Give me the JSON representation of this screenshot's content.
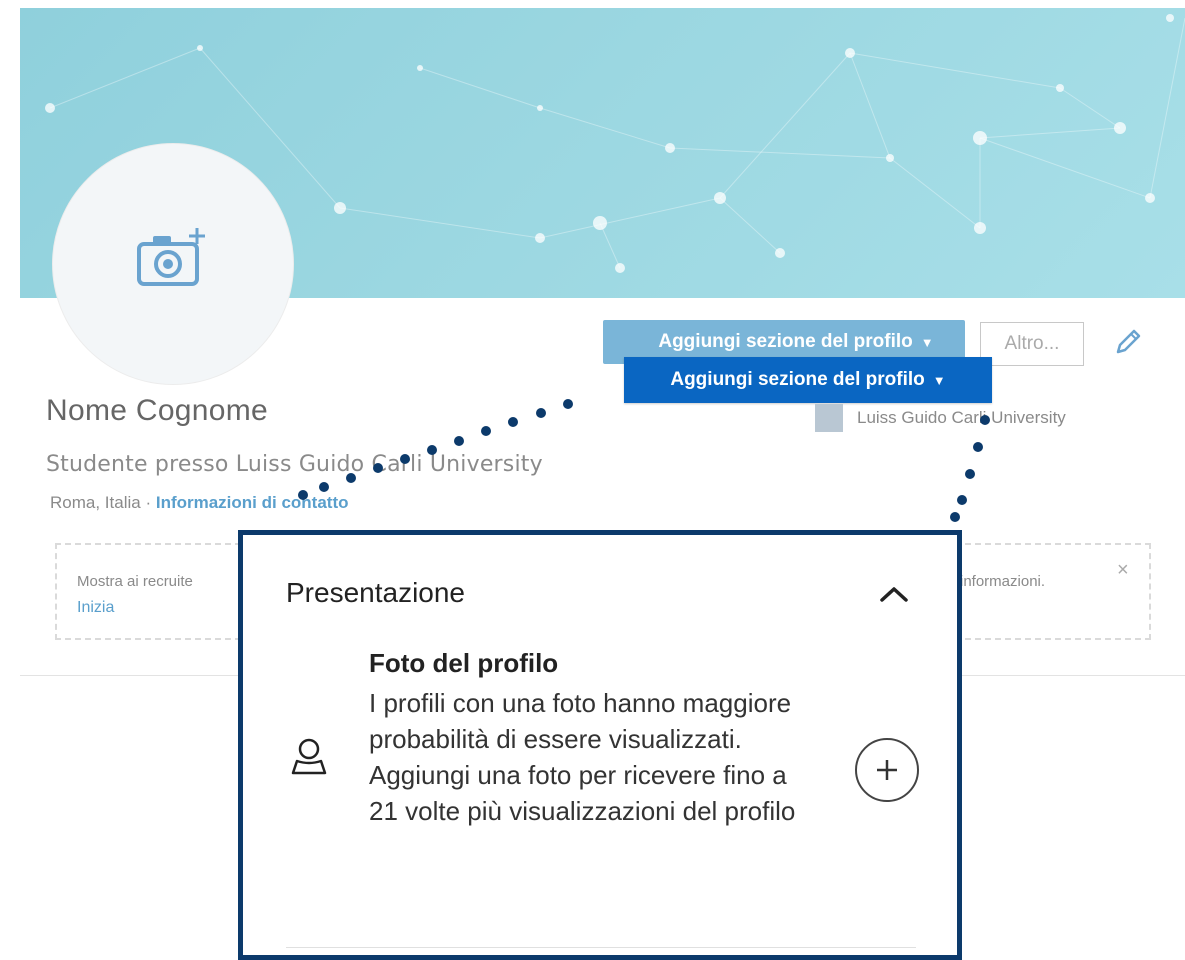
{
  "profile": {
    "name": "Nome Cognome",
    "headline": "Studente presso Luiss Guido Carli University",
    "location": "Roma, Italia",
    "separator": "·",
    "contact_link": "Informazioni di contatto",
    "school": "Luiss Guido Carli University"
  },
  "actions": {
    "add_section_label": "Aggiungi sezione del profilo",
    "add_section_caret": "▼",
    "more_label": "Altro...",
    "edit_icon": "pencil-icon"
  },
  "callout_button": {
    "label": "Aggiungi sezione del profilo",
    "caret": "▼"
  },
  "recruiter_banner": {
    "text_left": "Mostra ai recruite",
    "text_right": "informazioni.",
    "link": "Inizia",
    "close": "×"
  },
  "dropdown_panel": {
    "section_title": "Presentazione",
    "item": {
      "title": "Foto del profilo",
      "description": "I profili con una foto hanno maggiore probabilità di essere visualizzati. Aggiungi una foto per ricevere fino a 21 volte più visualizzazioni del profilo",
      "icon": "person-icon",
      "action_icon": "plus-circle-icon"
    }
  },
  "colors": {
    "banner": "#9bd7e1",
    "primary_button": "#0a66c2",
    "panel_border": "#0c3a6b",
    "link": "#5a9fcc"
  }
}
